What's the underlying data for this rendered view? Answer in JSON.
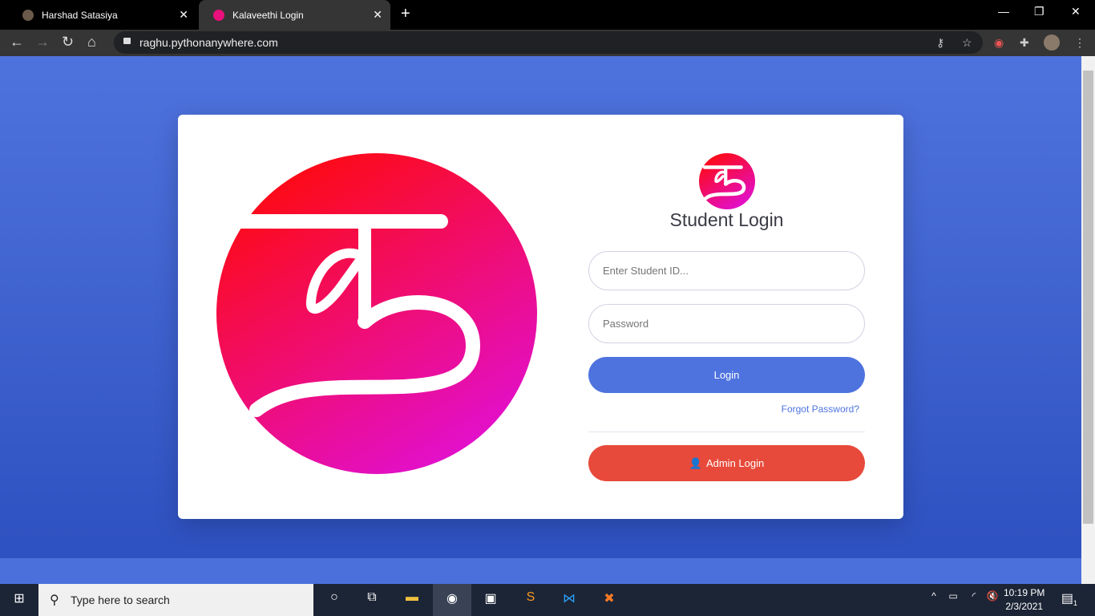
{
  "browser": {
    "tabs": [
      {
        "title": "Harshad Satasiya"
      },
      {
        "title": "Kalaveethi Login"
      }
    ],
    "url": "raghu.pythonanywhere.com"
  },
  "login": {
    "title": "Student Login",
    "student_id_placeholder": "Enter Student ID...",
    "password_placeholder": "Password",
    "login_label": "Login",
    "forgot_label": "Forgot Password?",
    "admin_label": "Admin Login"
  },
  "taskbar": {
    "search_placeholder": "Type here to search",
    "time": "10:19 PM",
    "date": "2/3/2021",
    "notifications": "1"
  },
  "colors": {
    "primary": "#4e73df",
    "danger": "#e74a3b",
    "logo_start": "#ff0a0a",
    "logo_end": "#e010d8"
  }
}
